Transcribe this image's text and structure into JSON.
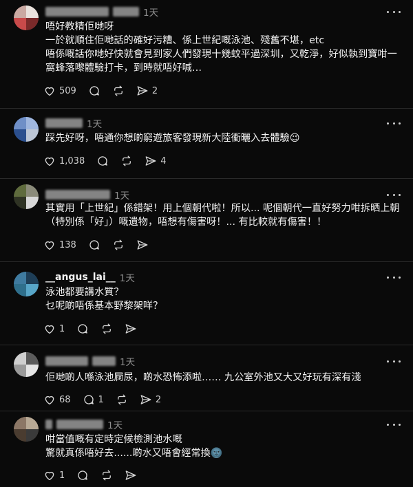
{
  "posts": [
    {
      "time": "1天",
      "username": "",
      "body": "唔好教精佢哋呀\n一於就順住佢哋話的確好污糟、係上世紀嘅泳池、殘舊不堪，etc\n唔係嘅話你哋好快就會見到家人們發現十幾蚊平過深圳，又乾淨，好似執到寶咁一\n窩蜂落嚟體驗打卡，到時就唔好喊…",
      "likes": "509",
      "replies": "",
      "reposts": "",
      "shares": "2"
    },
    {
      "time": "1天",
      "username": "",
      "body": "踩先好呀，唔通你想啲窮遊旅客發現新大陸衝曬入去體驗😉",
      "likes": "1,038",
      "replies": "",
      "reposts": "",
      "shares": "4"
    },
    {
      "time": "1天",
      "username": "",
      "body": "其實用「上世紀」係錯架！用上個朝代啦！所以... 呢個朝代一直好努力咁拆晒上朝\n（特別係「好」）嘅遺物，唔想有傷害呀！... 有比較就有傷害！！",
      "likes": "138",
      "replies": "",
      "reposts": "",
      "shares": ""
    },
    {
      "time": "1天",
      "username": "__angus_lai__",
      "body": "泳池都要講水質？\n乜呢啲唔係基本野黎架咩？",
      "likes": "1",
      "replies": "",
      "reposts": "",
      "shares": ""
    },
    {
      "time": "1天",
      "username": "",
      "body": "佢哋啲人喺泳池屙尿，啲水恐怖添啦…… 九公室外池又大又好玩有深有淺",
      "likes": "68",
      "replies": "1",
      "reposts": "",
      "shares": "2"
    },
    {
      "time": "1天",
      "username": "",
      "body": "咁當值嘅有定時定候檢測池水嘅\n驚就真係唔好去......啲水又唔會經常換🌚",
      "likes": "1",
      "replies": "",
      "reposts": "",
      "shares": ""
    }
  ]
}
